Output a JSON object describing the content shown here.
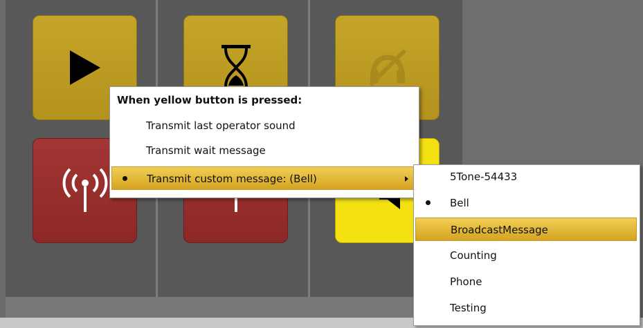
{
  "window": {
    "colors": {
      "gold": "#c5a528",
      "red": "#a33634",
      "yellow": "#f4e112",
      "highlight": "#e5b93a"
    }
  },
  "grid": {
    "buttons": [
      {
        "icon": "play-icon",
        "color": "gold"
      },
      {
        "icon": "hourglass-icon",
        "color": "gold"
      },
      {
        "icon": "headset-muted-icon",
        "color": "gold"
      },
      {
        "icon": "radio-transmit-icon",
        "color": "red"
      },
      {
        "icon": "radio-transmit-icon",
        "color": "red"
      },
      {
        "icon": "speaker-icon",
        "color": "yellow"
      }
    ]
  },
  "context_menu": {
    "header": "When yellow button is pressed:",
    "items": [
      {
        "label": "Transmit last operator sound",
        "selected": false
      },
      {
        "label": "Transmit wait message",
        "selected": false
      },
      {
        "label": "Transmit custom message: (Bell)",
        "selected": true,
        "has_submenu": true
      }
    ]
  },
  "submenu": {
    "items": [
      {
        "label": "5Tone-54433",
        "checked": false
      },
      {
        "label": "Bell",
        "checked": true
      },
      {
        "label": "BroadcastMessage",
        "checked": false,
        "highlighted": true
      },
      {
        "label": "Counting",
        "checked": false
      },
      {
        "label": "Phone",
        "checked": false
      },
      {
        "label": "Testing",
        "checked": false
      }
    ]
  }
}
